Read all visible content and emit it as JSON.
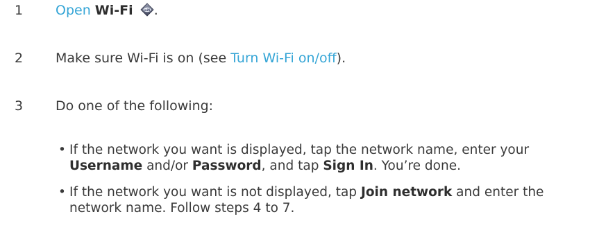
{
  "steps": [
    {
      "number": "1",
      "link": "Open",
      "bold": "Wi-Fi",
      "icon": "wifi-app-icon",
      "tail": "."
    },
    {
      "number": "2",
      "text_before": "Make sure Wi-Fi is on (see ",
      "link": "Turn Wi-Fi on/off",
      "text_after": ")."
    },
    {
      "number": "3",
      "text": "Do one of the following:"
    }
  ],
  "bullets": [
    {
      "marker": "•",
      "t1": "If the network you want is displayed, tap the network name, enter your ",
      "b1": "Username",
      "t2": " and/or ",
      "b2": "Password",
      "t3": ", and tap ",
      "b3": "Sign In",
      "t4": ". You’re done."
    },
    {
      "marker": "•",
      "t1": "If the network you want is not displayed, tap ",
      "b1": "Join network",
      "t2": " and enter the network name. Follow steps 4 to 7."
    }
  ],
  "colors": {
    "link": "#35a5d6",
    "text": "#3a3a3a"
  }
}
